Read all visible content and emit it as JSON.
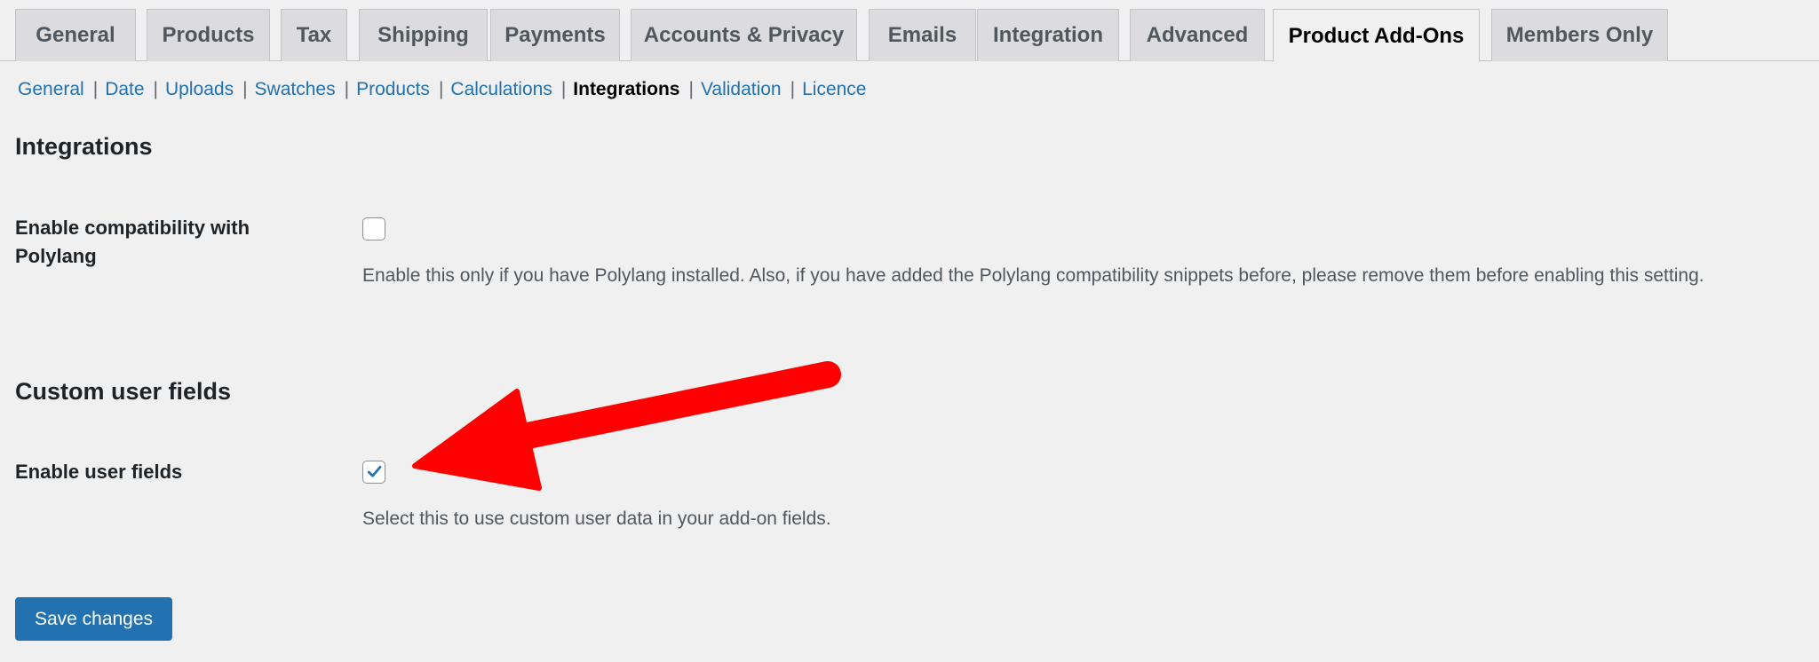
{
  "tabs": [
    {
      "label": "General"
    },
    {
      "label": "Products"
    },
    {
      "label": "Tax"
    },
    {
      "label": "Shipping"
    },
    {
      "label": "Payments"
    },
    {
      "label": "Accounts & Privacy"
    },
    {
      "label": "Emails"
    },
    {
      "label": "Integration"
    },
    {
      "label": "Advanced"
    },
    {
      "label": "Product Add-Ons"
    },
    {
      "label": "Members Only"
    }
  ],
  "active_tab": "Product Add-Ons",
  "subnav": [
    {
      "label": "General"
    },
    {
      "label": "Date"
    },
    {
      "label": "Uploads"
    },
    {
      "label": "Swatches"
    },
    {
      "label": "Products"
    },
    {
      "label": "Calculations"
    },
    {
      "label": "Integrations"
    },
    {
      "label": "Validation"
    },
    {
      "label": "Licence"
    }
  ],
  "active_subnav": "Integrations",
  "sections": {
    "integrations": {
      "heading": "Integrations",
      "setting_label": "Enable compatibility with Polylang",
      "checked": false,
      "description": "Enable this only if you have Polylang installed. Also, if you have added the Polylang compatibility snippets before, please remove them before enabling this setting."
    },
    "custom_user_fields": {
      "heading": "Custom user fields",
      "setting_label": "Enable user fields",
      "checked": true,
      "description": "Select this to use custom user data in your add-on fields."
    }
  },
  "save_button": {
    "label": "Save changes"
  },
  "colors": {
    "accent": "#2271b1",
    "annotation_arrow": "#ff0000",
    "background": "#f0f0f1"
  }
}
